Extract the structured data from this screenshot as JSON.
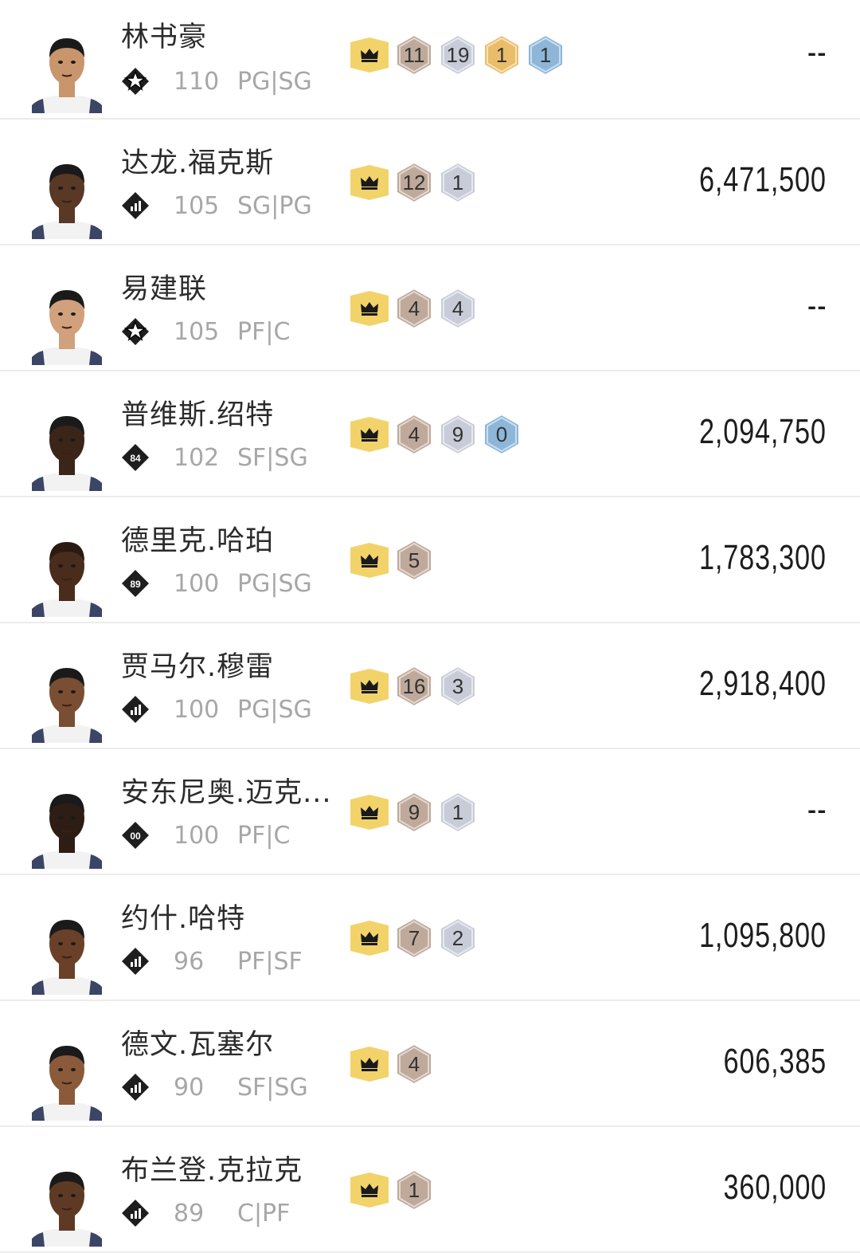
{
  "players": [
    {
      "name": "林书豪",
      "rating": "110",
      "position": "PG|SG",
      "tier_icon": "star-diamond-icon",
      "price": "--",
      "badges": [
        {
          "tier": "bronze",
          "count": "11"
        },
        {
          "tier": "silver",
          "count": "19"
        },
        {
          "tier": "gold",
          "count": "1"
        },
        {
          "tier": "hof",
          "count": "1"
        }
      ],
      "skin": "#c9956c",
      "hair": "#1a1a1a"
    },
    {
      "name": "达龙.福克斯",
      "rating": "105",
      "position": "SG|PG",
      "tier_icon": "bars-diamond-icon",
      "price": "6,471,500",
      "badges": [
        {
          "tier": "bronze",
          "count": "12"
        },
        {
          "tier": "silver",
          "count": "1"
        }
      ],
      "skin": "#5a3826",
      "hair": "#1a1a1a"
    },
    {
      "name": "易建联",
      "rating": "105",
      "position": "PF|C",
      "tier_icon": "star-diamond-icon",
      "price": "--",
      "badges": [
        {
          "tier": "bronze",
          "count": "4"
        },
        {
          "tier": "silver",
          "count": "4"
        }
      ],
      "skin": "#d1a07c",
      "hair": "#1a1a1a"
    },
    {
      "name": "普维斯.绍特",
      "rating": "102",
      "position": "SF|SG",
      "tier_icon": "84-diamond-icon",
      "tier_text": "84",
      "price": "2,094,750",
      "badges": [
        {
          "tier": "bronze",
          "count": "4"
        },
        {
          "tier": "silver",
          "count": "9"
        },
        {
          "tier": "hof",
          "count": "0"
        }
      ],
      "skin": "#3b2418",
      "hair": "#1a1a1a"
    },
    {
      "name": "德里克.哈珀",
      "rating": "100",
      "position": "PG|SG",
      "tier_icon": "89-diamond-icon",
      "tier_text": "89",
      "price": "1,783,300",
      "badges": [
        {
          "tier": "bronze",
          "count": "5"
        }
      ],
      "skin": "#4a2c1d",
      "hair": "#2a1a12"
    },
    {
      "name": "贾马尔.穆雷",
      "rating": "100",
      "position": "PG|SG",
      "tier_icon": "bars-diamond-icon",
      "price": "2,918,400",
      "badges": [
        {
          "tier": "bronze",
          "count": "16"
        },
        {
          "tier": "silver",
          "count": "3"
        }
      ],
      "skin": "#7a4e33",
      "hair": "#1a1a1a"
    },
    {
      "name": "安东尼奥.迈克...",
      "rating": "100",
      "position": "PF|C",
      "tier_icon": "00-diamond-icon",
      "tier_text": "00",
      "price": "--",
      "badges": [
        {
          "tier": "bronze",
          "count": "9"
        },
        {
          "tier": "silver",
          "count": "1"
        }
      ],
      "skin": "#2e1d14",
      "hair": "#1a1a1a"
    },
    {
      "name": "约什.哈特",
      "rating": "96",
      "position": "PF|SF",
      "tier_icon": "bars-diamond-icon",
      "price": "1,095,800",
      "badges": [
        {
          "tier": "bronze",
          "count": "7"
        },
        {
          "tier": "silver",
          "count": "2"
        }
      ],
      "skin": "#6a4028",
      "hair": "#1a1a1a"
    },
    {
      "name": "德文.瓦塞尔",
      "rating": "90",
      "position": "SF|SG",
      "tier_icon": "bars-diamond-icon",
      "price": "606,385",
      "badges": [
        {
          "tier": "bronze",
          "count": "4"
        }
      ],
      "skin": "#8a5a3a",
      "hair": "#1a1a1a"
    },
    {
      "name": "布兰登.克拉克",
      "rating": "89",
      "position": "C|PF",
      "tier_icon": "bars-diamond-icon",
      "price": "360,000",
      "badges": [
        {
          "tier": "bronze",
          "count": "1"
        }
      ],
      "skin": "#5e3a25",
      "hair": "#1a1a1a"
    }
  ],
  "colors": {
    "bronze": "#bfa99a",
    "silver": "#c8ccd8",
    "gold": "#e9bd6a",
    "hof": "#8db6d9",
    "crown_bg": "#f2d36a"
  }
}
